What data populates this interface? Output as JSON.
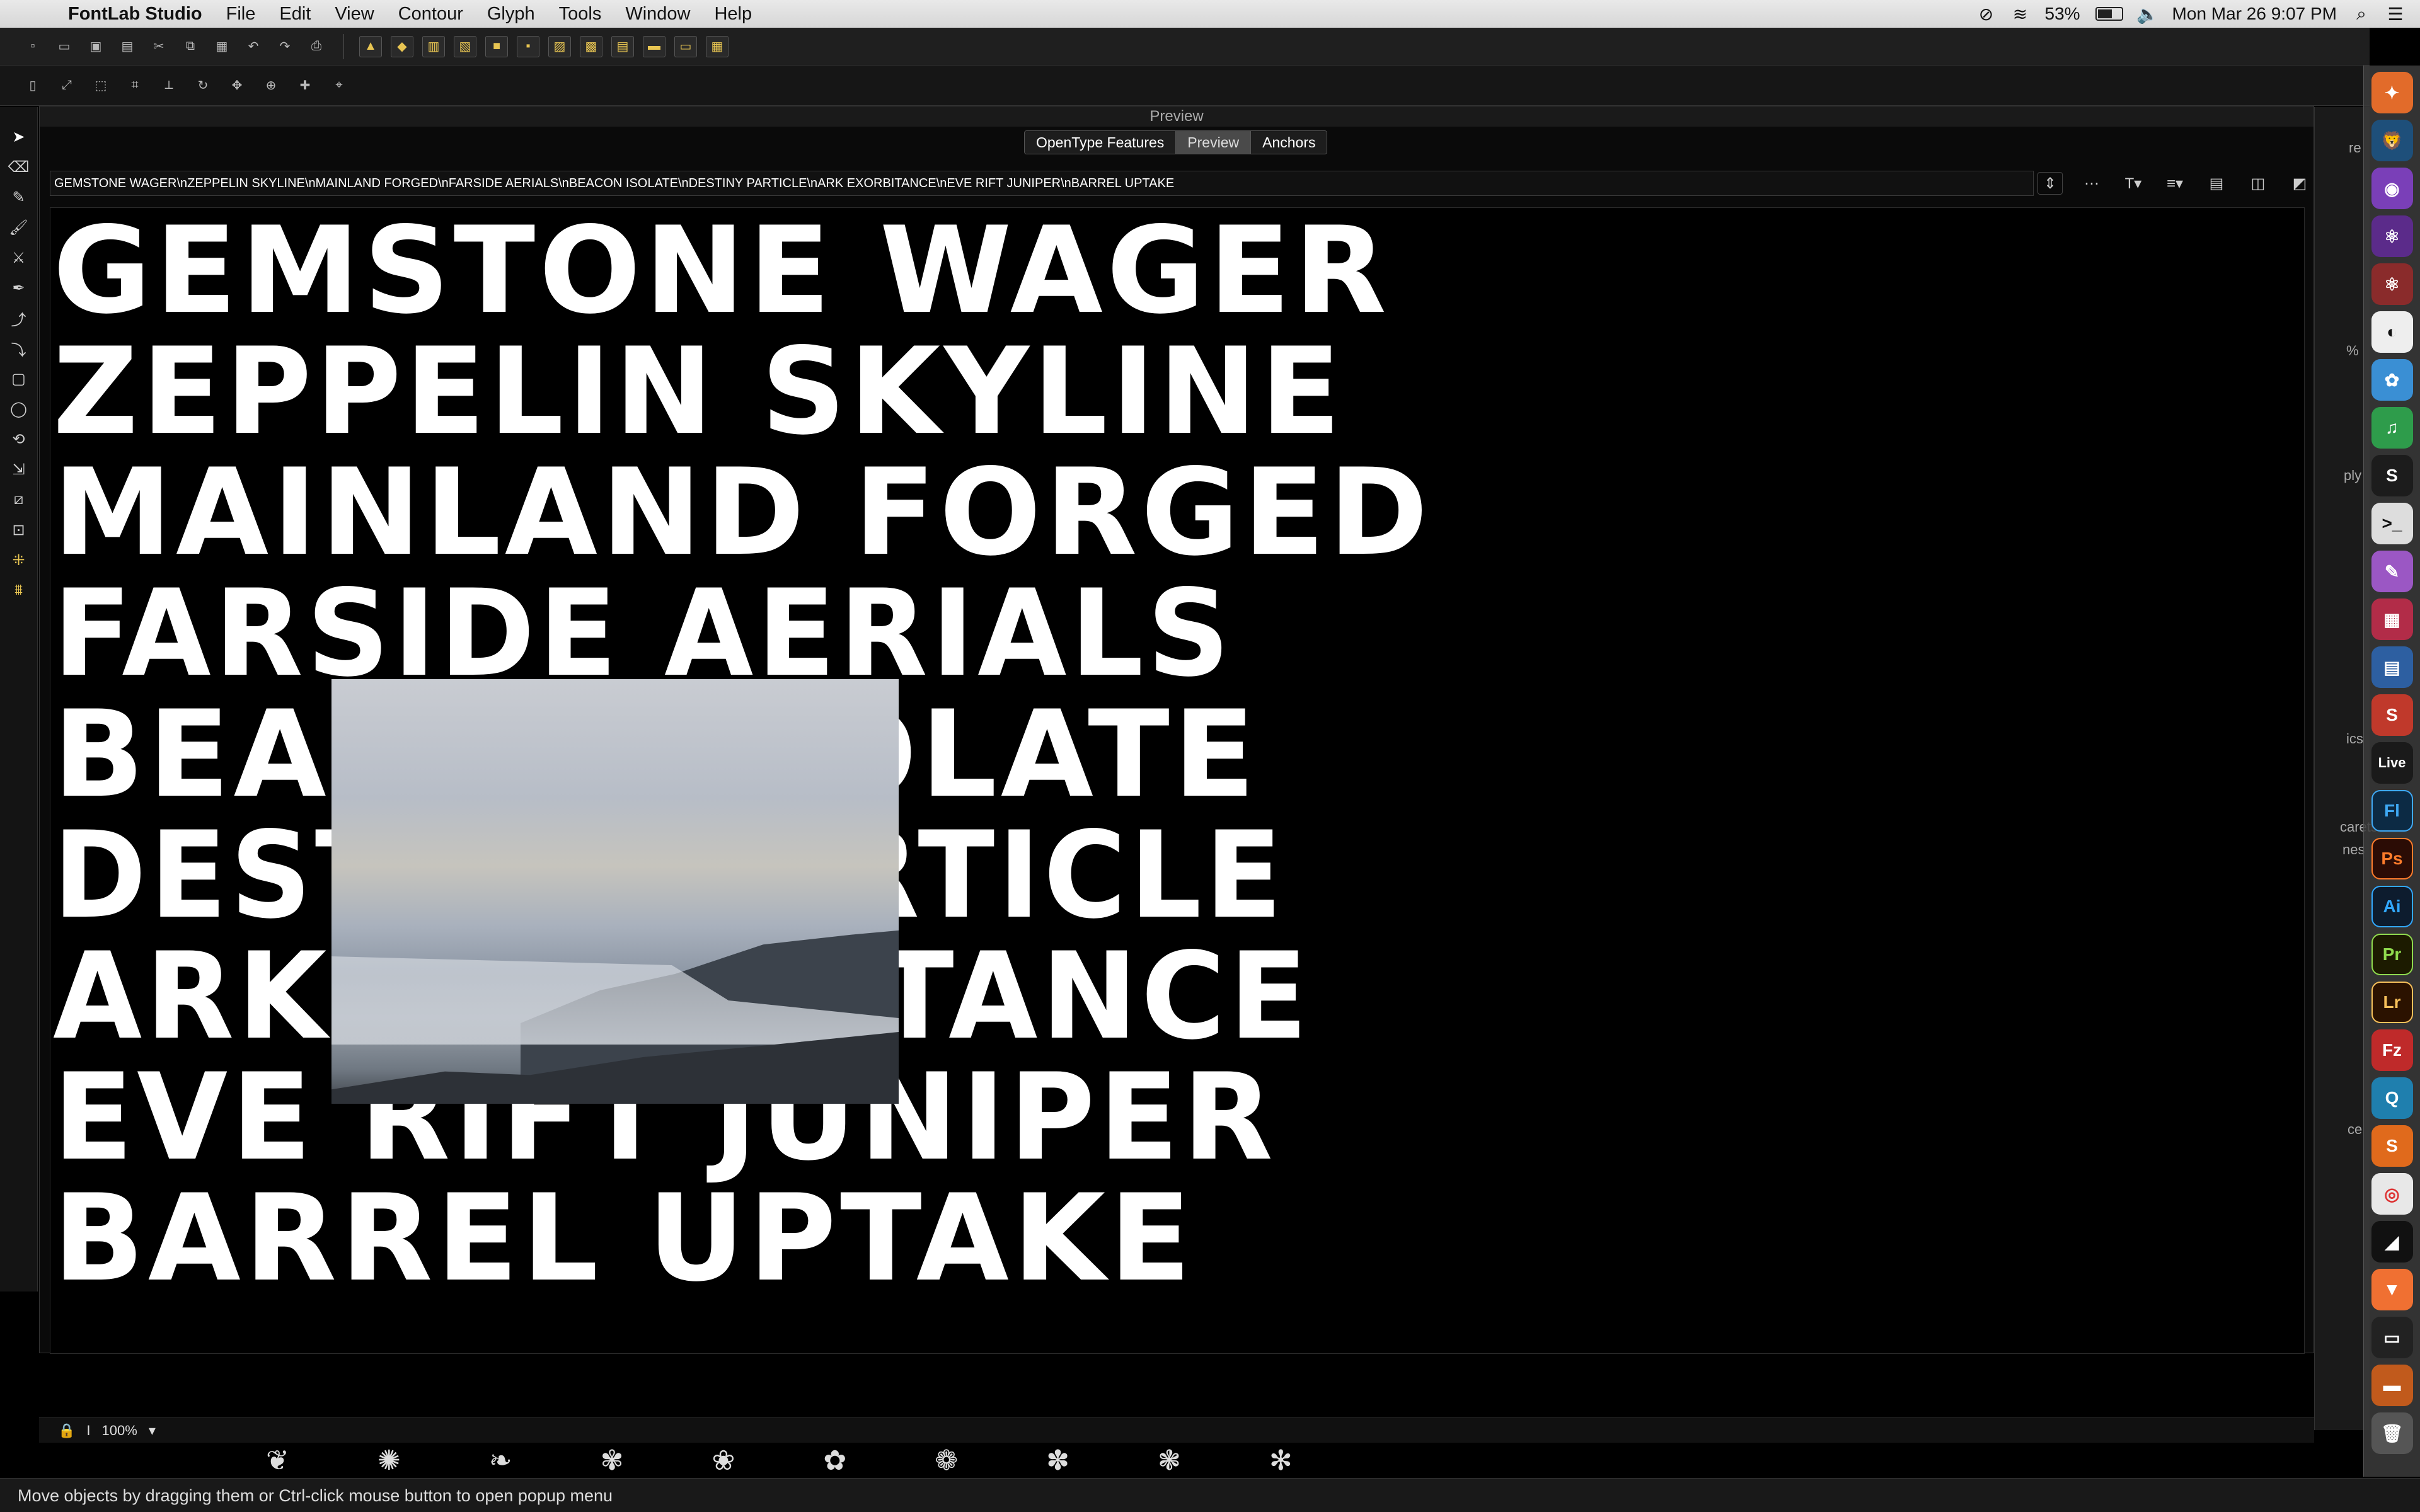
{
  "menubar": {
    "app_name": "FontLab Studio",
    "items": [
      "File",
      "Edit",
      "View",
      "Contour",
      "Glyph",
      "Tools",
      "Window",
      "Help"
    ],
    "battery": "53%",
    "datetime": "Mon Mar 26  9:07 PM"
  },
  "panel": {
    "title": "Preview",
    "tabs": [
      "OpenType Features",
      "Preview",
      "Anchors"
    ],
    "active_tab": "Preview",
    "text_field_value": "GEMSTONE WAGER\\nZEPPELIN SKYLINE\\nMAINLAND FORGED\\nFARSIDE AERIALS\\nBEACON ISOLATE\\nDESTINY PARTICLE\\nARK EXORBITANCE\\nEVE RIFT JUNIPER\\nBARREL UPTAKE",
    "zoom": "100%"
  },
  "preview_lines": [
    "GEMSTONE WAGER",
    "ZEPPELIN SKYLINE",
    "MAINLAND FORGED",
    "FARSIDE AERIALS",
    "BEACON ISOLATE",
    "DESTINY PARTICLE",
    "ARK EXORBITANCE",
    "EVE RIFT JUNIPER",
    "BARREL UPTAKE"
  ],
  "inspector": {
    "percent": "%",
    "apply": "ply",
    "ics": "ics",
    "carets": "carets",
    "nes": "nes",
    "ce": "ce",
    "re": "re"
  },
  "dock": [
    "Live",
    "Fl",
    "Ps",
    "Ai",
    "Pr",
    "Lr",
    "Fz",
    "Q",
    "S"
  ],
  "status_text": "Move objects by dragging them or Ctrl-click mouse button to open popup menu"
}
